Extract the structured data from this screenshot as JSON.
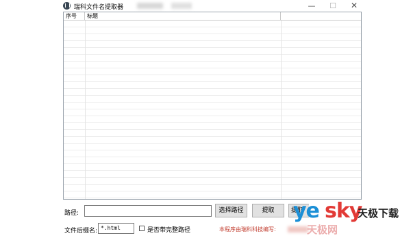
{
  "window": {
    "title": "瑞科文件名提取器",
    "min_glyph": "—",
    "max_glyph": "☐",
    "close_glyph": "✕",
    "icon": "app-icon"
  },
  "list": {
    "columns": [
      "序号",
      "标题",
      ""
    ]
  },
  "path": {
    "label": "路径:",
    "value": ""
  },
  "buttons": {
    "select_path": "选择路径",
    "extract": "提取",
    "extract2": "提取"
  },
  "extension": {
    "label": "文件后缀名:",
    "value": "*.html"
  },
  "full_path_checkbox": {
    "label": "是否带完整路径",
    "checked": false
  },
  "credit": "本程序由瑞科科技编写:",
  "watermark": {
    "ye": "ye",
    "sky": "sky",
    "brand": "天极下载",
    "sub": "天极网"
  },
  "colors": {
    "accent_blue": "#1b8fd6",
    "accent_red": "#e23a36",
    "credit_red": "#c0392b"
  }
}
